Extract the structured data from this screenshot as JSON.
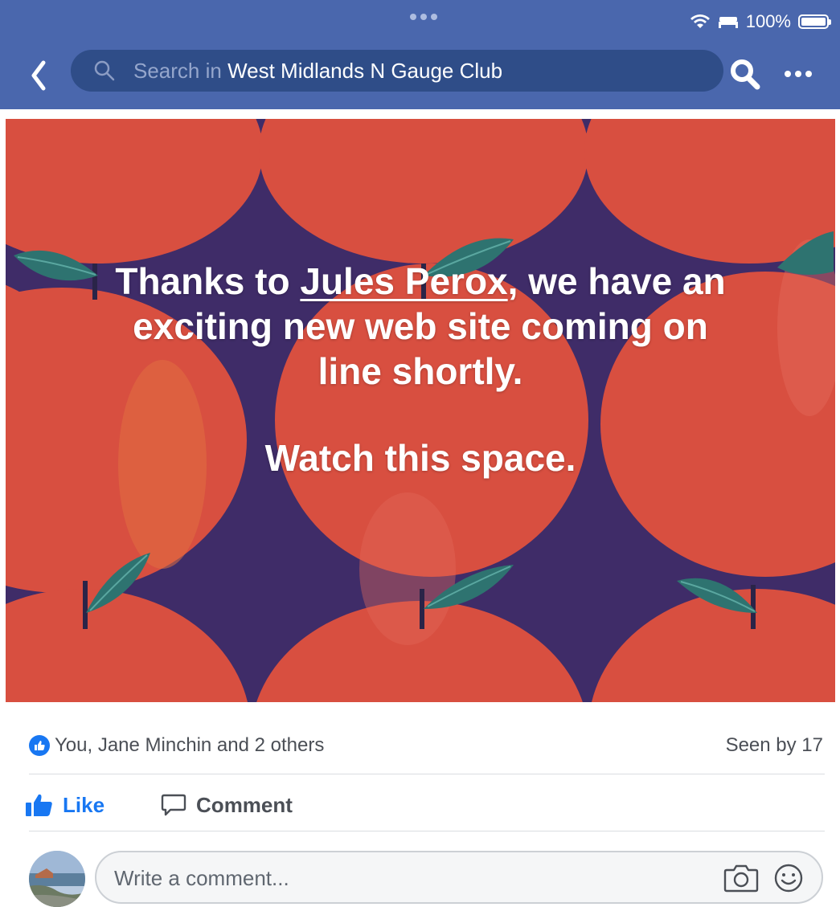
{
  "status_bar": {
    "battery": "100%",
    "battery_level": 1.0
  },
  "header": {
    "search_placeholder": "Search in ",
    "group_name": "West Midlands N Gauge Club"
  },
  "post": {
    "line1_pre": "Thanks to ",
    "tagged_person": "Jules Perox",
    "line1_post": ", we have an",
    "line2": "exciting new web site coming on",
    "line3": "line shortly.",
    "line4": "Watch this space.",
    "background_colors": {
      "fruit": "#d84f40",
      "backdrop": "#3f2c68",
      "leaf": "#2e7370"
    }
  },
  "reactions": {
    "summary": "You, Jane Minchin and 2 others",
    "seen": "Seen by 17"
  },
  "actions": {
    "like": "Like",
    "comment": "Comment"
  },
  "composer": {
    "placeholder": "Write a comment...",
    "icons": [
      "camera-icon",
      "emoji-icon"
    ]
  },
  "colors": {
    "header": "#4a67ad",
    "search_bar": "#2f4d88",
    "accent": "#1877f2"
  }
}
